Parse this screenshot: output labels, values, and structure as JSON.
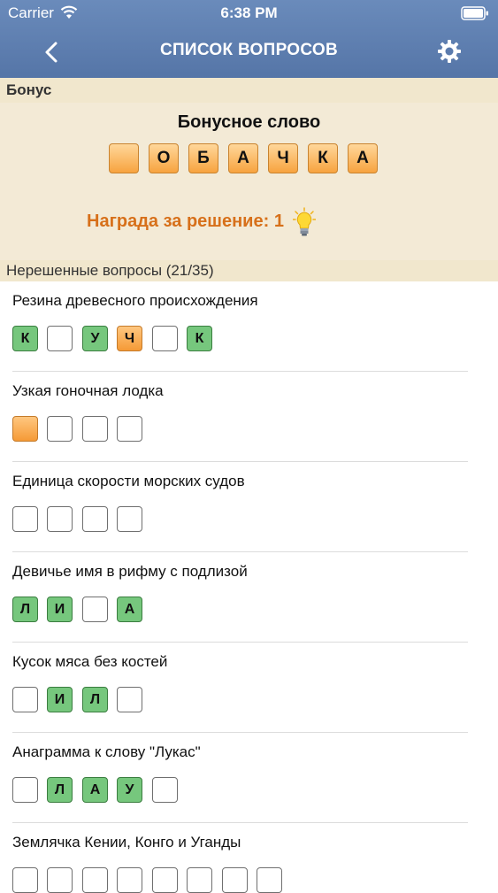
{
  "status_bar": {
    "carrier": "Carrier",
    "time": "6:38 PM"
  },
  "nav": {
    "title": "СПИСОК ВОПРОСОВ",
    "back_icon": "chevron-left-icon",
    "settings_icon": "gear-icon"
  },
  "bonus_section": {
    "header": "Бонус",
    "title": "Бонусное слово",
    "letters": [
      "",
      "О",
      "Б",
      "А",
      "Ч",
      "К",
      "А"
    ],
    "reward": "Награда за решение: 1",
    "reward_icon": "lightbulb-icon"
  },
  "unsolved_section": {
    "header": "Нерешенные вопросы (21/35)",
    "questions": [
      {
        "text": "Резина древесного происхождения",
        "tiles": [
          {
            "letter": "К",
            "state": "green"
          },
          {
            "letter": "",
            "state": "empty"
          },
          {
            "letter": "У",
            "state": "green"
          },
          {
            "letter": "Ч",
            "state": "orange"
          },
          {
            "letter": "",
            "state": "empty"
          },
          {
            "letter": "К",
            "state": "green"
          }
        ]
      },
      {
        "text": "Узкая гоночная лодка",
        "tiles": [
          {
            "letter": "",
            "state": "orange"
          },
          {
            "letter": "",
            "state": "empty"
          },
          {
            "letter": "",
            "state": "empty"
          },
          {
            "letter": "",
            "state": "empty"
          }
        ]
      },
      {
        "text": "Единица скорости морских судов",
        "tiles": [
          {
            "letter": "",
            "state": "empty"
          },
          {
            "letter": "",
            "state": "empty"
          },
          {
            "letter": "",
            "state": "empty"
          },
          {
            "letter": "",
            "state": "empty"
          }
        ]
      },
      {
        "text": "Девичье имя в рифму с подлизой",
        "tiles": [
          {
            "letter": "Л",
            "state": "green"
          },
          {
            "letter": "И",
            "state": "green"
          },
          {
            "letter": "",
            "state": "empty"
          },
          {
            "letter": "А",
            "state": "green"
          }
        ]
      },
      {
        "text": "Кусок мяса без костей",
        "tiles": [
          {
            "letter": "",
            "state": "empty"
          },
          {
            "letter": "И",
            "state": "green"
          },
          {
            "letter": "Л",
            "state": "green"
          },
          {
            "letter": "",
            "state": "empty"
          }
        ]
      },
      {
        "text": "Анаграмма к слову \"Лукас\"",
        "tiles": [
          {
            "letter": "",
            "state": "empty"
          },
          {
            "letter": "Л",
            "state": "green"
          },
          {
            "letter": "А",
            "state": "green"
          },
          {
            "letter": "У",
            "state": "green"
          },
          {
            "letter": "",
            "state": "empty"
          }
        ]
      },
      {
        "text": "Землячка Кении, Конго и Уганды",
        "tiles": [
          {
            "letter": "",
            "state": "empty"
          },
          {
            "letter": "",
            "state": "empty"
          },
          {
            "letter": "",
            "state": "empty"
          },
          {
            "letter": "",
            "state": "empty"
          },
          {
            "letter": "",
            "state": "empty"
          },
          {
            "letter": "",
            "state": "empty"
          },
          {
            "letter": "",
            "state": "empty"
          },
          {
            "letter": "",
            "state": "empty"
          }
        ]
      }
    ]
  },
  "colors": {
    "nav_bar": "#5a7aac",
    "section_bg": "#f1e7cd",
    "tile_green": "#76c77d",
    "tile_orange": "#f7a33f",
    "reward_text": "#d7701a"
  }
}
